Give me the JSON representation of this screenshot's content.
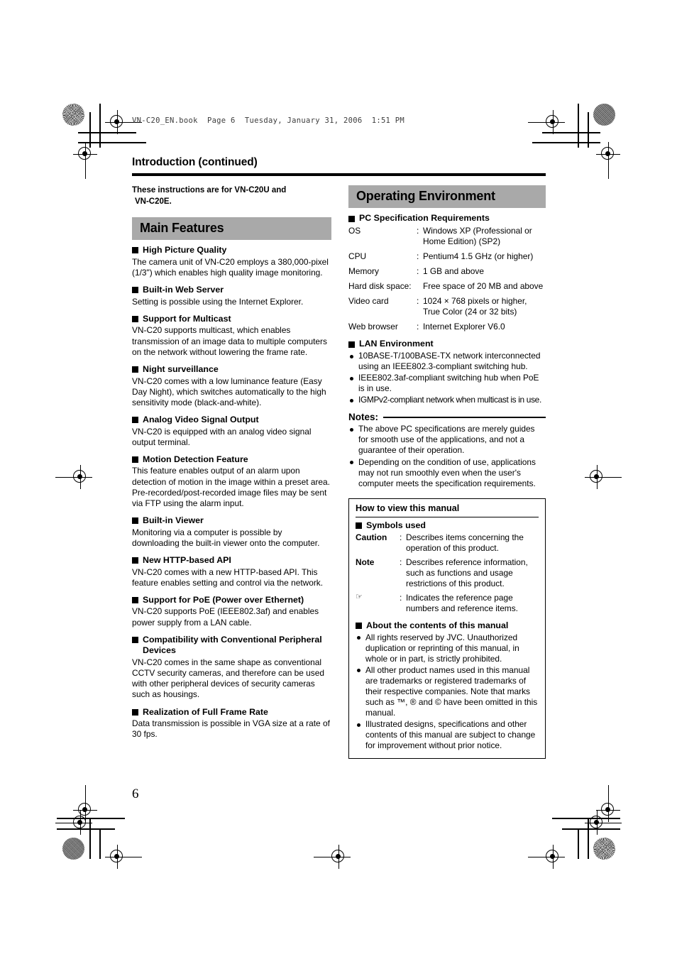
{
  "file_header": "VN-C20_EN.book  Page 6  Tuesday, January 31, 2006  1:51 PM",
  "page_title": "Introduction (continued)",
  "folio": "6",
  "colors": {
    "band_gray": "#a9a9a9",
    "rule_black": "#000000"
  },
  "left_column": {
    "intro_note_line1": "These instructions are for VN-C20U and",
    "intro_note_line2": "VN-C20E.",
    "band_title": "Main Features",
    "features": [
      {
        "heading": "High Picture Quality",
        "body": "The camera unit of VN-C20 employs a 380,000-pixel (1/3\") which enables high quality image monitoring."
      },
      {
        "heading": "Built-in Web Server",
        "body": "Setting is possible using the Internet Explorer."
      },
      {
        "heading": "Support for Multicast",
        "body": "VN-C20 supports multicast, which enables transmission of an image data to multiple computers on the network without lowering the frame rate."
      },
      {
        "heading": "Night surveillance",
        "body": "VN-C20 comes with a low luminance feature (Easy Day Night), which switches automatically to the high sensitivity mode (black-and-white)."
      },
      {
        "heading": "Analog Video Signal Output",
        "body": "VN-C20 is equipped with an analog video signal output terminal."
      },
      {
        "heading": "Motion Detection Feature",
        "body": "This feature enables output of an alarm upon detection of motion in the image within a preset area.\nPre-recorded/post-recorded image files may be sent via FTP using the alarm input."
      },
      {
        "heading": "Built-in Viewer",
        "body": "Monitoring via a computer is possible by downloading the built-in viewer onto the computer."
      },
      {
        "heading": "New HTTP-based API",
        "body": "VN-C20 comes with a new HTTP-based API. This feature enables setting and control via the network."
      },
      {
        "heading": "Support for PoE (Power over Ethernet)",
        "body": "VN-C20 supports PoE (IEEE802.3af) and enables power supply from a LAN cable."
      },
      {
        "heading": "Compatibility with Conventional Peripheral Devices",
        "body": "VN-C20 comes in the same shape as conventional CCTV security cameras, and therefore can be used with other peripheral devices of security cameras such as housings."
      },
      {
        "heading": "Realization of Full Frame Rate",
        "body": "Data transmission is possible in VGA size at a rate of 30 fps."
      }
    ]
  },
  "right_column": {
    "band_title": "Operating Environment",
    "pc_spec": {
      "heading": "PC Specification Requirements",
      "rows": [
        {
          "key": "OS",
          "sep": ":",
          "value": "Windows XP (Professional or Home Edition) (SP2)"
        },
        {
          "key": "CPU",
          "sep": ":",
          "value": "Pentium4 1.5 GHz (or higher)"
        },
        {
          "key": "Memory",
          "sep": ":",
          "value": "1 GB and above"
        },
        {
          "key": "Hard disk space:",
          "sep": "",
          "value": "Free space of 20 MB and above"
        },
        {
          "key": "Video card",
          "sep": ":",
          "value": "1024 × 768 pixels or higher, True Color (24 or 32 bits)"
        },
        {
          "key": "Web browser",
          "sep": ":",
          "value": "Internet Explorer V6.0"
        }
      ]
    },
    "lan": {
      "heading": "LAN Environment",
      "items": [
        "10BASE-T/100BASE-TX network interconnected using an IEEE802.3-compliant switching hub.",
        "IEEE802.3af-compliant switching hub when PoE is in use.",
        "IGMPv2-compliant network when multicast is in use."
      ]
    },
    "notes": {
      "heading": "Notes:",
      "items": [
        "The above PC specifications are merely guides for smooth use of the applications, and not a guarantee of their operation.",
        "Depending on the condition of use, applications may not run smoothly even when the user's computer meets the specification requirements."
      ]
    },
    "manual_box": {
      "title": "How to view this manual",
      "symbols_heading": "Symbols used",
      "symbols": [
        {
          "key": "Caution",
          "sep": ":",
          "value": "Describes items concerning the operation of this product."
        },
        {
          "key": "Note",
          "sep": ":",
          "value": "Describes reference information, such as functions and usage restrictions of this product."
        },
        {
          "key": "☞",
          "sep": ":",
          "value": "Indicates the reference page numbers and reference items."
        }
      ],
      "about_heading": "About the contents of this manual",
      "about_items": [
        "All rights reserved by JVC. Unauthorized duplication or reprinting of this manual, in whole or in part, is strictly prohibited.",
        "All other product names used in this manual are trademarks or registered trademarks of their respective companies. Note that marks such as ™, ® and © have been omitted in this manual.",
        "Illustrated designs, specifications and other contents of this manual are subject to change for improvement without prior notice."
      ]
    }
  }
}
